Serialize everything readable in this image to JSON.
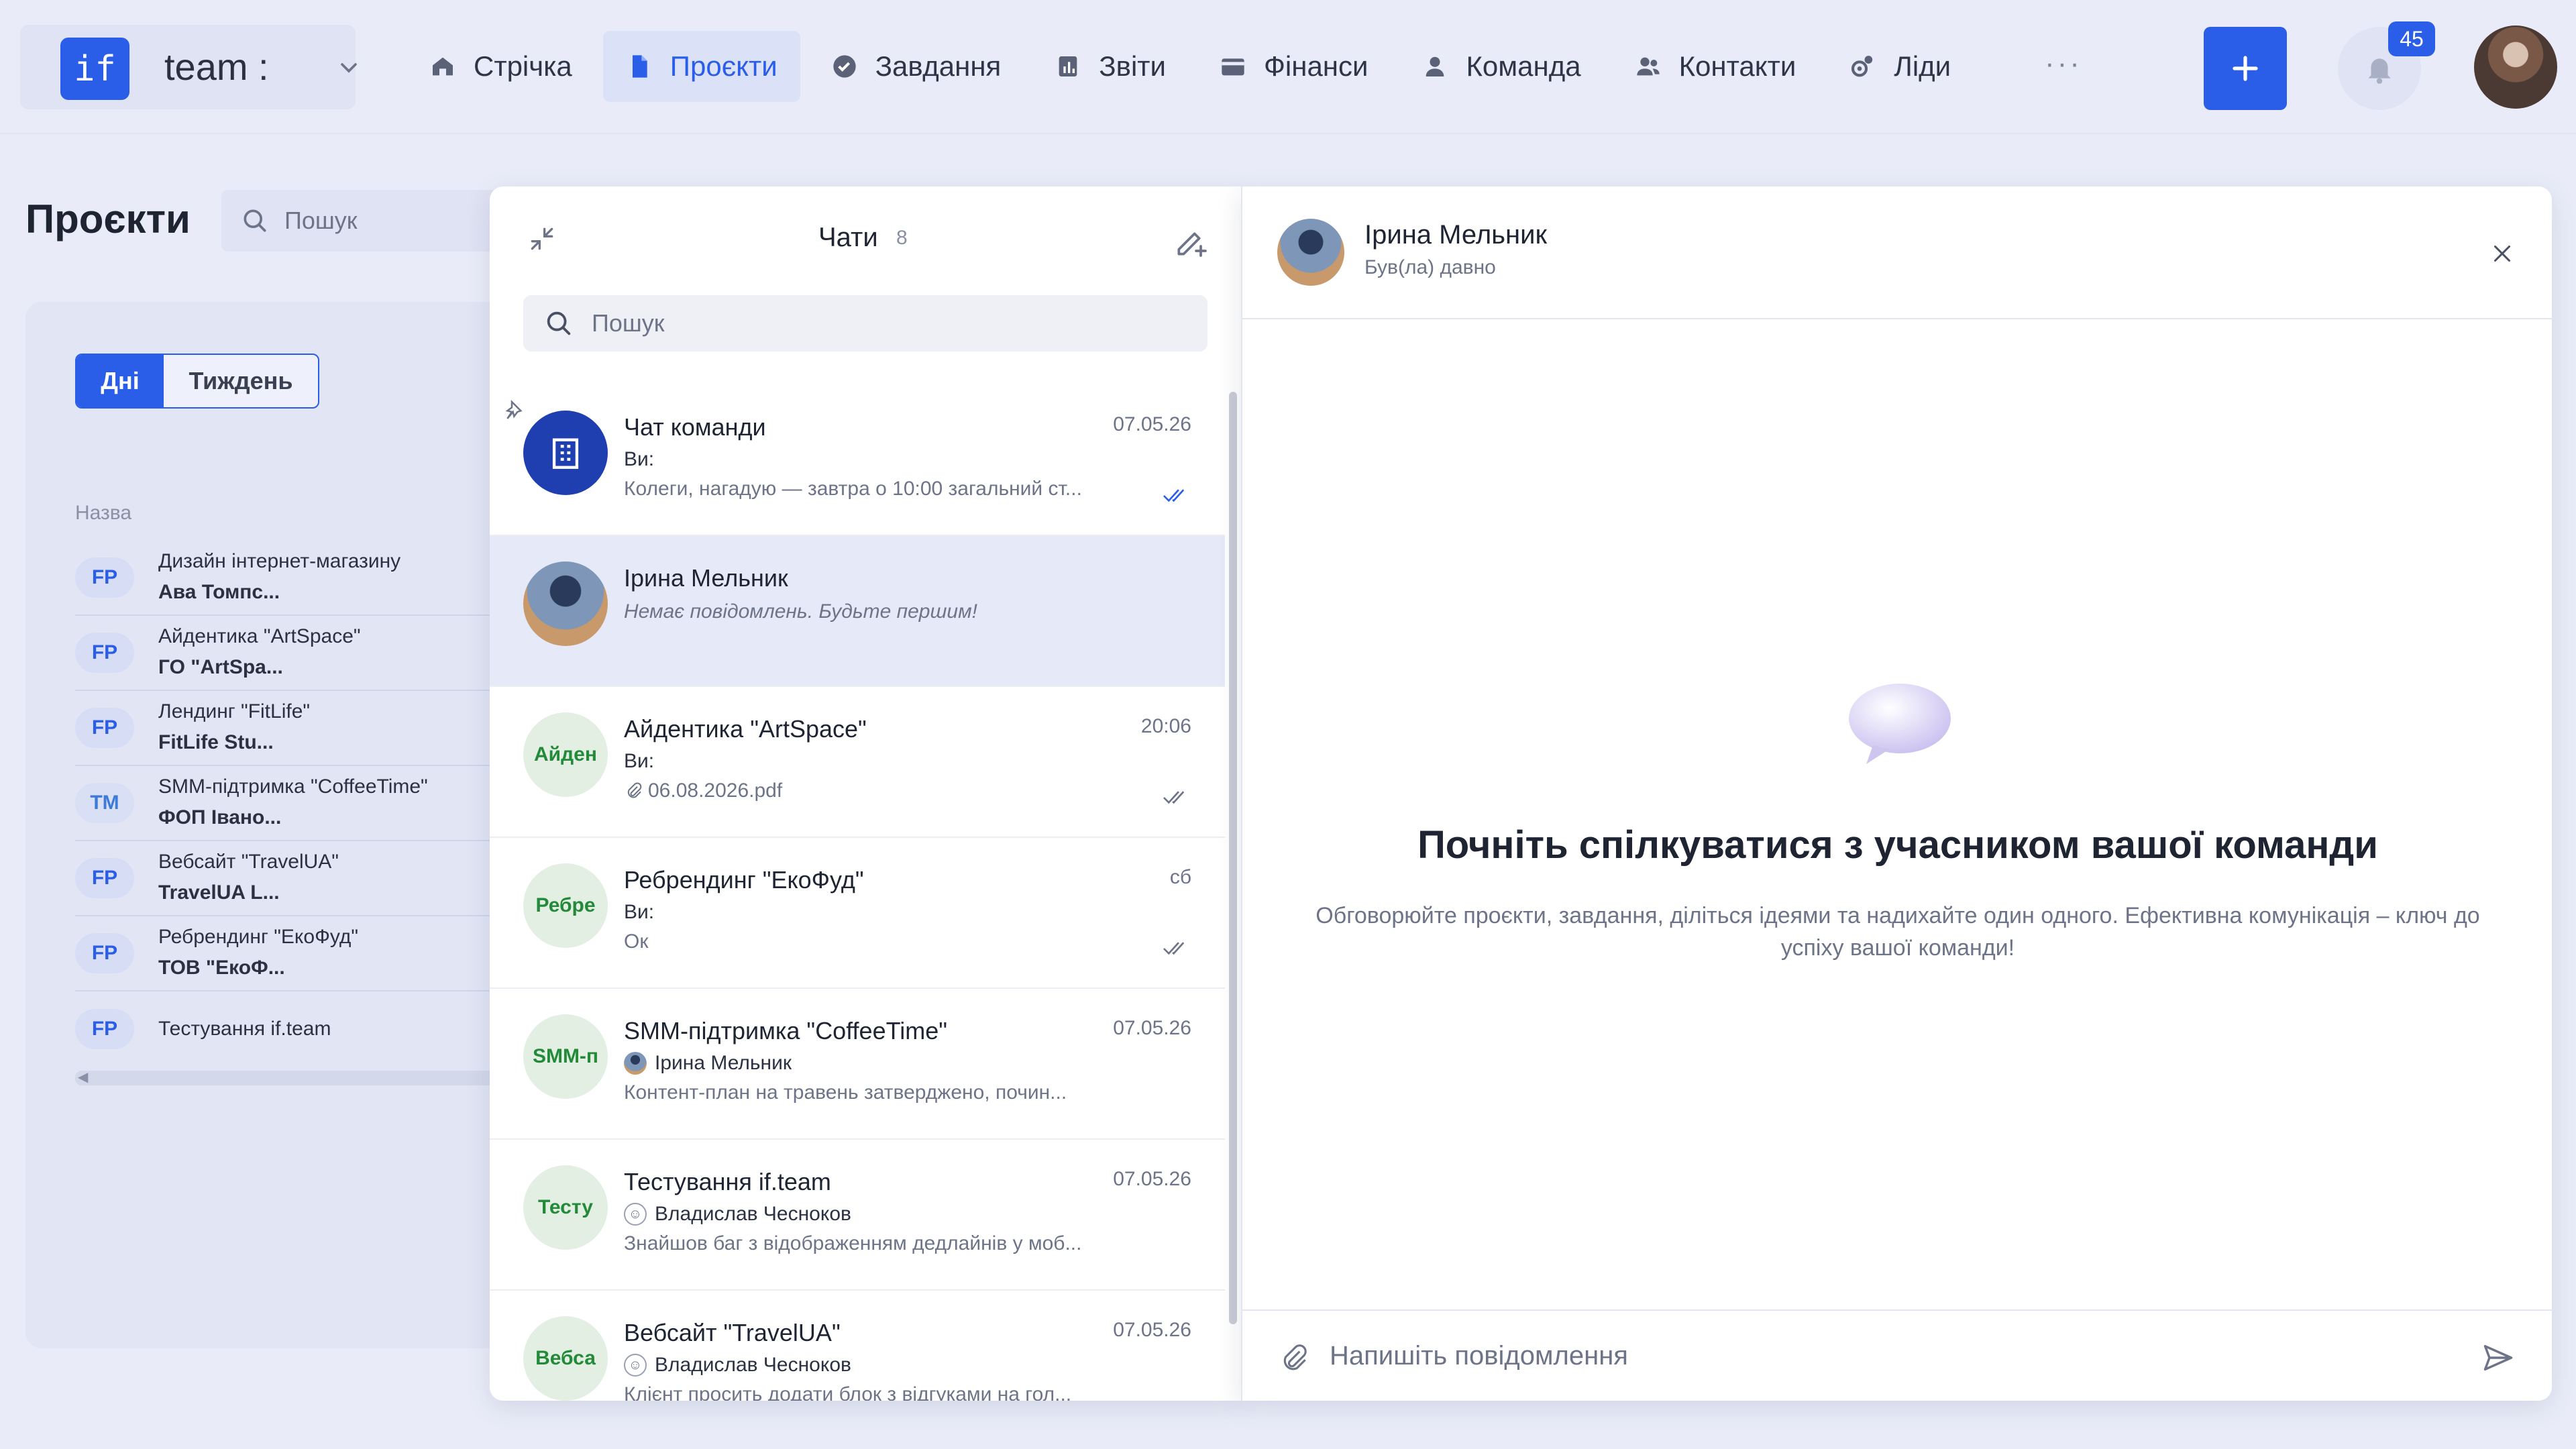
{
  "brand": {
    "logo": "if",
    "name": "team :"
  },
  "nav": [
    {
      "label": "Стрічка",
      "icon": "home-icon"
    },
    {
      "label": "Проєкти",
      "icon": "document-icon",
      "active": true
    },
    {
      "label": "Завдання",
      "icon": "check-circle-icon"
    },
    {
      "label": "Звіти",
      "icon": "report-icon"
    },
    {
      "label": "Фінанси",
      "icon": "wallet-icon"
    },
    {
      "label": "Команда",
      "icon": "person-icon"
    },
    {
      "label": "Контакти",
      "icon": "contacts-icon"
    },
    {
      "label": "Ліди",
      "icon": "leads-icon"
    }
  ],
  "topbar": {
    "more": "···",
    "notifications_count": "45"
  },
  "projects_page": {
    "title": "Проєкти",
    "search_placeholder": "Пошук",
    "toggle_days": "Дні",
    "toggle_week": "Тиждень",
    "column_name": "Назва",
    "items": [
      {
        "tag": "FP",
        "title": "Дизайн інтернет-магазину",
        "client": "Ава Томпс..."
      },
      {
        "tag": "FP",
        "title": "Айдентика \"ArtSpace\"",
        "client": "ГО \"ArtSpa..."
      },
      {
        "tag": "FP",
        "title": "Лендинг \"FitLife\"",
        "client": "FitLife Stu..."
      },
      {
        "tag": "TM",
        "title": "SMM-підтримка \"CoffeeTime\"",
        "client": "ФОП Івано..."
      },
      {
        "tag": "FP",
        "title": "Вебсайт \"TravelUA\"",
        "client": "TravelUA L..."
      },
      {
        "tag": "FP",
        "title": "Ребрендинг \"ЕкоФуд\"",
        "client": "ТОВ \"ЕкоФ..."
      },
      {
        "tag": "FP",
        "title": "Тестування if.team",
        "client": ""
      }
    ]
  },
  "chats": {
    "title": "Чати",
    "count": "8",
    "search_placeholder": "Пошук",
    "items": [
      {
        "avatar_type": "team",
        "initials": "",
        "name": "Чат команди",
        "date": "07.05.26",
        "sender": "Ви:",
        "sender_avatar": "",
        "preview": "Колеги, нагадую — завтра о 10:00 загальний ст...",
        "read": true,
        "pinned": true,
        "italic": false,
        "check_color": "#2a5ee8"
      },
      {
        "avatar_type": "photo",
        "initials": "",
        "name": "Ірина Мельник",
        "date": "",
        "sender": "",
        "sender_avatar": "",
        "preview": "Немає повідомлень. Будьте першим!",
        "read": false,
        "pinned": false,
        "italic": true,
        "active": true
      },
      {
        "avatar_type": "initials",
        "initials": "Айден",
        "name": "Айдентика \"ArtSpace\"",
        "date": "20:06",
        "sender": "Ви:",
        "sender_avatar": "",
        "preview": "06.08.2026.pdf",
        "attachment": true,
        "read": true,
        "pinned": false,
        "italic": false,
        "check_color": "#6d7488"
      },
      {
        "avatar_type": "initials",
        "initials": "Ребре",
        "name": "Ребрендинг \"ЕкоФуд\"",
        "date": "сб",
        "sender": "Ви:",
        "sender_avatar": "",
        "preview": "Ок",
        "read": true,
        "pinned": false,
        "italic": false,
        "check_color": "#6d7488"
      },
      {
        "avatar_type": "initials",
        "initials": "SMM-п",
        "name": "SMM-підтримка \"CoffeeTime\"",
        "date": "07.05.26",
        "sender": "Ірина Мельник",
        "sender_avatar": "photo",
        "preview": "Контент-план на травень затверджено, почин...",
        "read": false,
        "pinned": false,
        "italic": false
      },
      {
        "avatar_type": "initials",
        "initials": "Тесту",
        "name": "Тестування if.team",
        "date": "07.05.26",
        "sender": "Владислав Чесноков",
        "sender_avatar": "robot",
        "preview": "Знайшов баг з відображенням дедлайнів у моб...",
        "read": false,
        "pinned": false,
        "italic": false
      },
      {
        "avatar_type": "initials",
        "initials": "Вебса",
        "name": "Вебсайт \"TravelUA\"",
        "date": "07.05.26",
        "sender": "Владислав Чесноков",
        "sender_avatar": "robot",
        "preview": "Клієнт просить додати блок з відгуками на гол...",
        "read": false,
        "pinned": false,
        "italic": false
      }
    ]
  },
  "conversation": {
    "name": "Ірина Мельник",
    "status": "Був(ла) давно",
    "empty_title": "Почніть спілкуватися з учасником вашої команди",
    "empty_desc": "Обговорюйте проєкти, завдання, діліться ідеями та надихайте один одного. Ефективна комунікація – ключ до успіху вашої команди!",
    "input_placeholder": "Напишіть повідомлення"
  }
}
